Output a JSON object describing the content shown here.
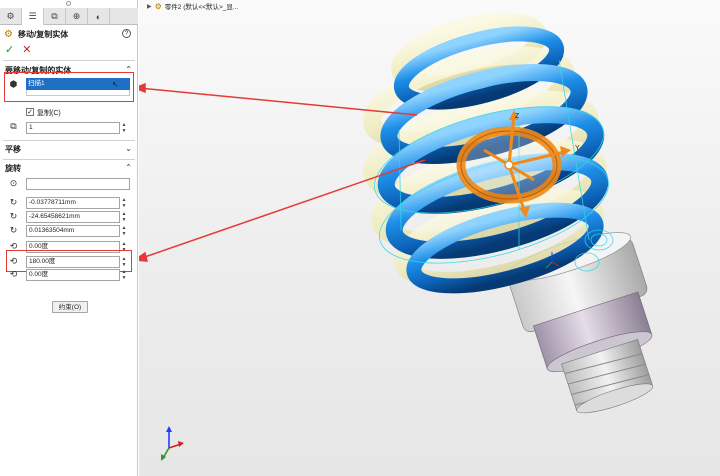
{
  "breadcrumb": {
    "arrow": "▶",
    "text": "零件2 (默认<<默认>_显..."
  },
  "property_manager": {
    "title": "移动/复制实体",
    "help": "?",
    "ok": "✓",
    "cancel": "✕",
    "section_bodies": {
      "label": "要移动/复制的实体",
      "selected_item": "扫描1"
    },
    "copy_checkbox": {
      "label": "复制(C)",
      "checked": true
    },
    "copy_count": "1",
    "section_translate": {
      "label": "平移"
    },
    "section_rotate": {
      "label": "旋转",
      "origin_field": "",
      "x": "-0.03778711mm",
      "y": "-24.65458621mm",
      "z": "0.01363504mm",
      "angle_x": "0.00度",
      "angle_y": "180.00度",
      "angle_z": "0.00度"
    },
    "constraint_button": "约束(O)"
  },
  "triad_labels": {
    "z": "Z",
    "y": "Y"
  },
  "colors": {
    "accent_blue": "#1f6fc5",
    "callout_red": "#e53935",
    "highlight_orange": "#f08a1c"
  }
}
